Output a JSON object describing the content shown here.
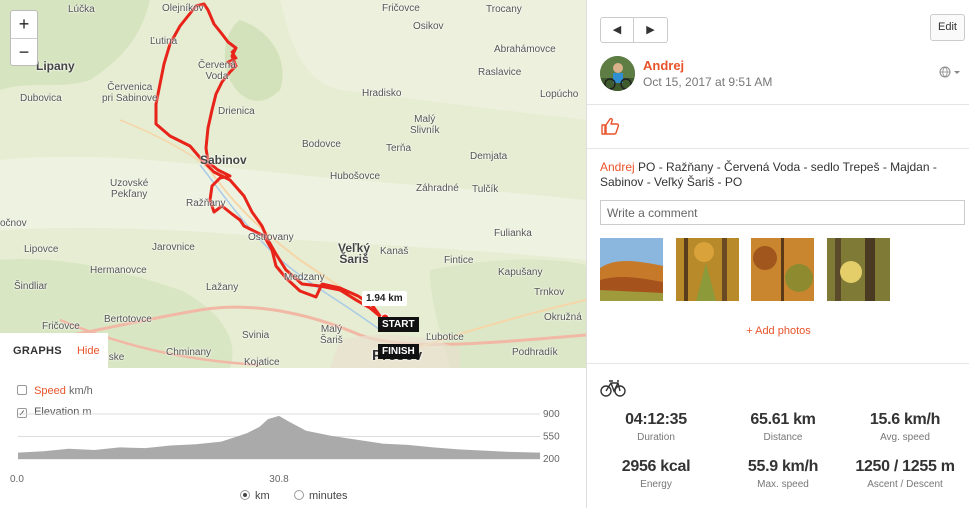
{
  "map": {
    "zoom_in": "+",
    "zoom_out": "−",
    "places": [
      {
        "text": "Lúčka",
        "cls": ""
      },
      {
        "text": "Olejníkov",
        "cls": ""
      },
      {
        "text": "Fričovce",
        "cls": ""
      },
      {
        "text": "Trocany",
        "cls": ""
      },
      {
        "text": "Osikov",
        "cls": ""
      },
      {
        "text": "Abrahámovce",
        "cls": ""
      },
      {
        "text": "Ľutina",
        "cls": ""
      },
      {
        "text": "Červená\nVoda",
        "cls": ""
      },
      {
        "text": "Lipany",
        "cls": "big"
      },
      {
        "text": "Raslavice",
        "cls": ""
      },
      {
        "text": "Dubovica",
        "cls": ""
      },
      {
        "text": "Červenica\npri Sabinove",
        "cls": ""
      },
      {
        "text": "Hradisko",
        "cls": ""
      },
      {
        "text": "Lopúcho",
        "cls": ""
      },
      {
        "text": "Drienica",
        "cls": ""
      },
      {
        "text": "Malý\nSlivník",
        "cls": ""
      },
      {
        "text": "Bodovce",
        "cls": ""
      },
      {
        "text": "Terňa",
        "cls": ""
      },
      {
        "text": "Demjata",
        "cls": ""
      },
      {
        "text": "Sabinov",
        "cls": "big"
      },
      {
        "text": "Hubošovce",
        "cls": ""
      },
      {
        "text": "Uzovské\nPekľany",
        "cls": ""
      },
      {
        "text": "Záhradné",
        "cls": ""
      },
      {
        "text": "Tulčík",
        "cls": ""
      },
      {
        "text": "Ražňany",
        "cls": ""
      },
      {
        "text": "očnov",
        "cls": ""
      },
      {
        "text": "Fulianka",
        "cls": ""
      },
      {
        "text": "Ostrovany",
        "cls": ""
      },
      {
        "text": "Lipovce",
        "cls": ""
      },
      {
        "text": "Jarovnice",
        "cls": ""
      },
      {
        "text": "Veľký\nŠariš",
        "cls": "big"
      },
      {
        "text": "Kanaš",
        "cls": ""
      },
      {
        "text": "Fintice",
        "cls": ""
      },
      {
        "text": "Hermanovce",
        "cls": ""
      },
      {
        "text": "Kapušany",
        "cls": ""
      },
      {
        "text": "Medzany",
        "cls": ""
      },
      {
        "text": "Šindliar",
        "cls": ""
      },
      {
        "text": "Lažany",
        "cls": ""
      },
      {
        "text": "Trnkov",
        "cls": ""
      },
      {
        "text": "Fričovce",
        "cls": ""
      },
      {
        "text": "Bertotovce",
        "cls": ""
      },
      {
        "text": "Svinia",
        "cls": ""
      },
      {
        "text": "Malý\nŠariš",
        "cls": ""
      },
      {
        "text": "Ľubotice",
        "cls": ""
      },
      {
        "text": "Okružná",
        "cls": ""
      },
      {
        "text": "Chminany",
        "cls": ""
      },
      {
        "text": "ninianske",
        "cls": ""
      },
      {
        "text": "Kojatice",
        "cls": ""
      },
      {
        "text": "Podhradík",
        "cls": ""
      },
      {
        "text": "Prešov",
        "cls": "huge"
      }
    ],
    "distance_label": "1.94 km",
    "start_label": "START",
    "finish_label": "FINISH"
  },
  "graphs": {
    "title": "GRAPHS",
    "hide_label": "Hide",
    "speed": {
      "label": "Speed",
      "unit": "km/h",
      "checked": false
    },
    "elevation": {
      "label": "Elevation",
      "unit": "m",
      "checked": true
    },
    "y_ticks": [
      "900",
      "550",
      "200"
    ],
    "x_ticks": [
      "0.0",
      "30.8"
    ],
    "x_units": [
      {
        "label": "km",
        "selected": true
      },
      {
        "label": "minutes",
        "selected": false
      }
    ]
  },
  "chart_data": {
    "type": "area",
    "title": "",
    "xlabel": "",
    "ylabel": "",
    "series": [
      {
        "name": "Elevation",
        "x": [
          0,
          3,
          6,
          9,
          12,
          15,
          18,
          21,
          24,
          27,
          28.5,
          29.5,
          30.8,
          32,
          34,
          37,
          40,
          43,
          46,
          49,
          52,
          55,
          58,
          61.6
        ],
        "values": [
          300,
          320,
          360,
          340,
          380,
          370,
          410,
          430,
          470,
          600,
          700,
          820,
          870,
          780,
          640,
          560,
          500,
          440,
          420,
          380,
          350,
          330,
          310,
          300
        ]
      }
    ],
    "ylim": [
      200,
      900
    ],
    "xlim": [
      0,
      61.6
    ],
    "color": "#aaaaaa"
  },
  "panel": {
    "prev_icon": "◀",
    "next_icon": "▶",
    "edit_label": "Edit",
    "athlete": "Andrej",
    "date": "Oct 15, 2017 at 9:51 AM",
    "privacy_icon": "globe-icon",
    "description_prefix": "Andrej",
    "description": "PO - Ražňany - Červená Voda - sedlo Trepeš - Majdan - Sabinov - Veľký Šariš - PO",
    "comment_placeholder": "Write a comment",
    "add_photos": "+ Add photos",
    "accent": "#e8542a",
    "stats": [
      {
        "value": "04:12:35",
        "label": "Duration"
      },
      {
        "value": "65.61 km",
        "label": "Distance"
      },
      {
        "value": "15.6 km/h",
        "label": "Avg. speed"
      },
      {
        "value": "2956 kcal",
        "label": "Energy"
      },
      {
        "value": "55.9 km/h",
        "label": "Max. speed"
      },
      {
        "value": "1250 / 1255 m",
        "label": "Ascent / Descent"
      }
    ]
  }
}
